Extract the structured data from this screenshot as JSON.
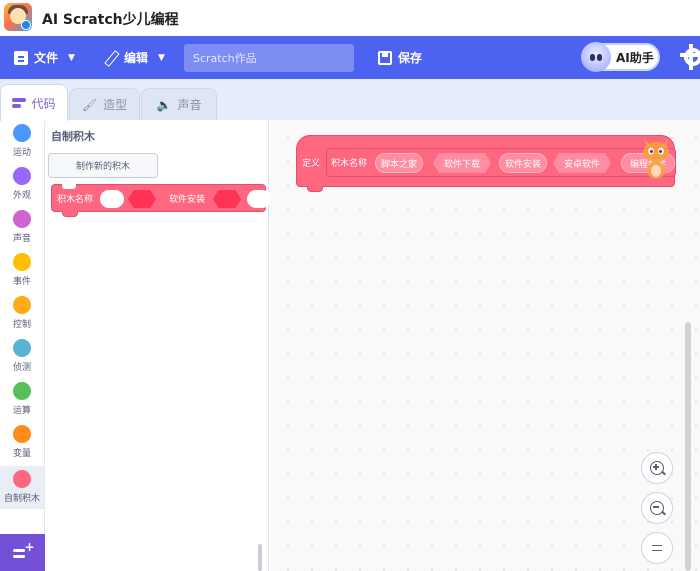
{
  "app": {
    "title": "AI Scratch少儿编程"
  },
  "menubar": {
    "file_label": "文件",
    "edit_label": "编辑",
    "project_placeholder": "Scratch作品",
    "save_label": "保存",
    "ai_label": "AI助手"
  },
  "tabs": [
    {
      "label": "代码"
    },
    {
      "label": "造型"
    },
    {
      "label": "声音"
    }
  ],
  "categories": [
    {
      "label": "运动",
      "color": "#4c97ff"
    },
    {
      "label": "外观",
      "color": "#9966ff"
    },
    {
      "label": "声音",
      "color": "#cf63cf"
    },
    {
      "label": "事件",
      "color": "#ffbf00"
    },
    {
      "label": "控制",
      "color": "#ffab19"
    },
    {
      "label": "侦测",
      "color": "#5cb1d6"
    },
    {
      "label": "运算",
      "color": "#59c059"
    },
    {
      "label": "变量",
      "color": "#ff8c1a"
    },
    {
      "label": "自制积木",
      "color": "#ff6680"
    }
  ],
  "flyout": {
    "title": "自制积木",
    "make_block_label": "制作新的积木",
    "block": {
      "name": "积木名称",
      "label2": "软件安装"
    }
  },
  "workspace": {
    "define_label": "定义",
    "name_label": "积木名称",
    "args": [
      "脚本之家",
      "软件下载",
      "软件安装",
      "安卓软件",
      "编程教学"
    ]
  },
  "colors": {
    "accent": "#4c62f0",
    "custom_block": "#ff6680",
    "tab_active": "#855cd6"
  }
}
